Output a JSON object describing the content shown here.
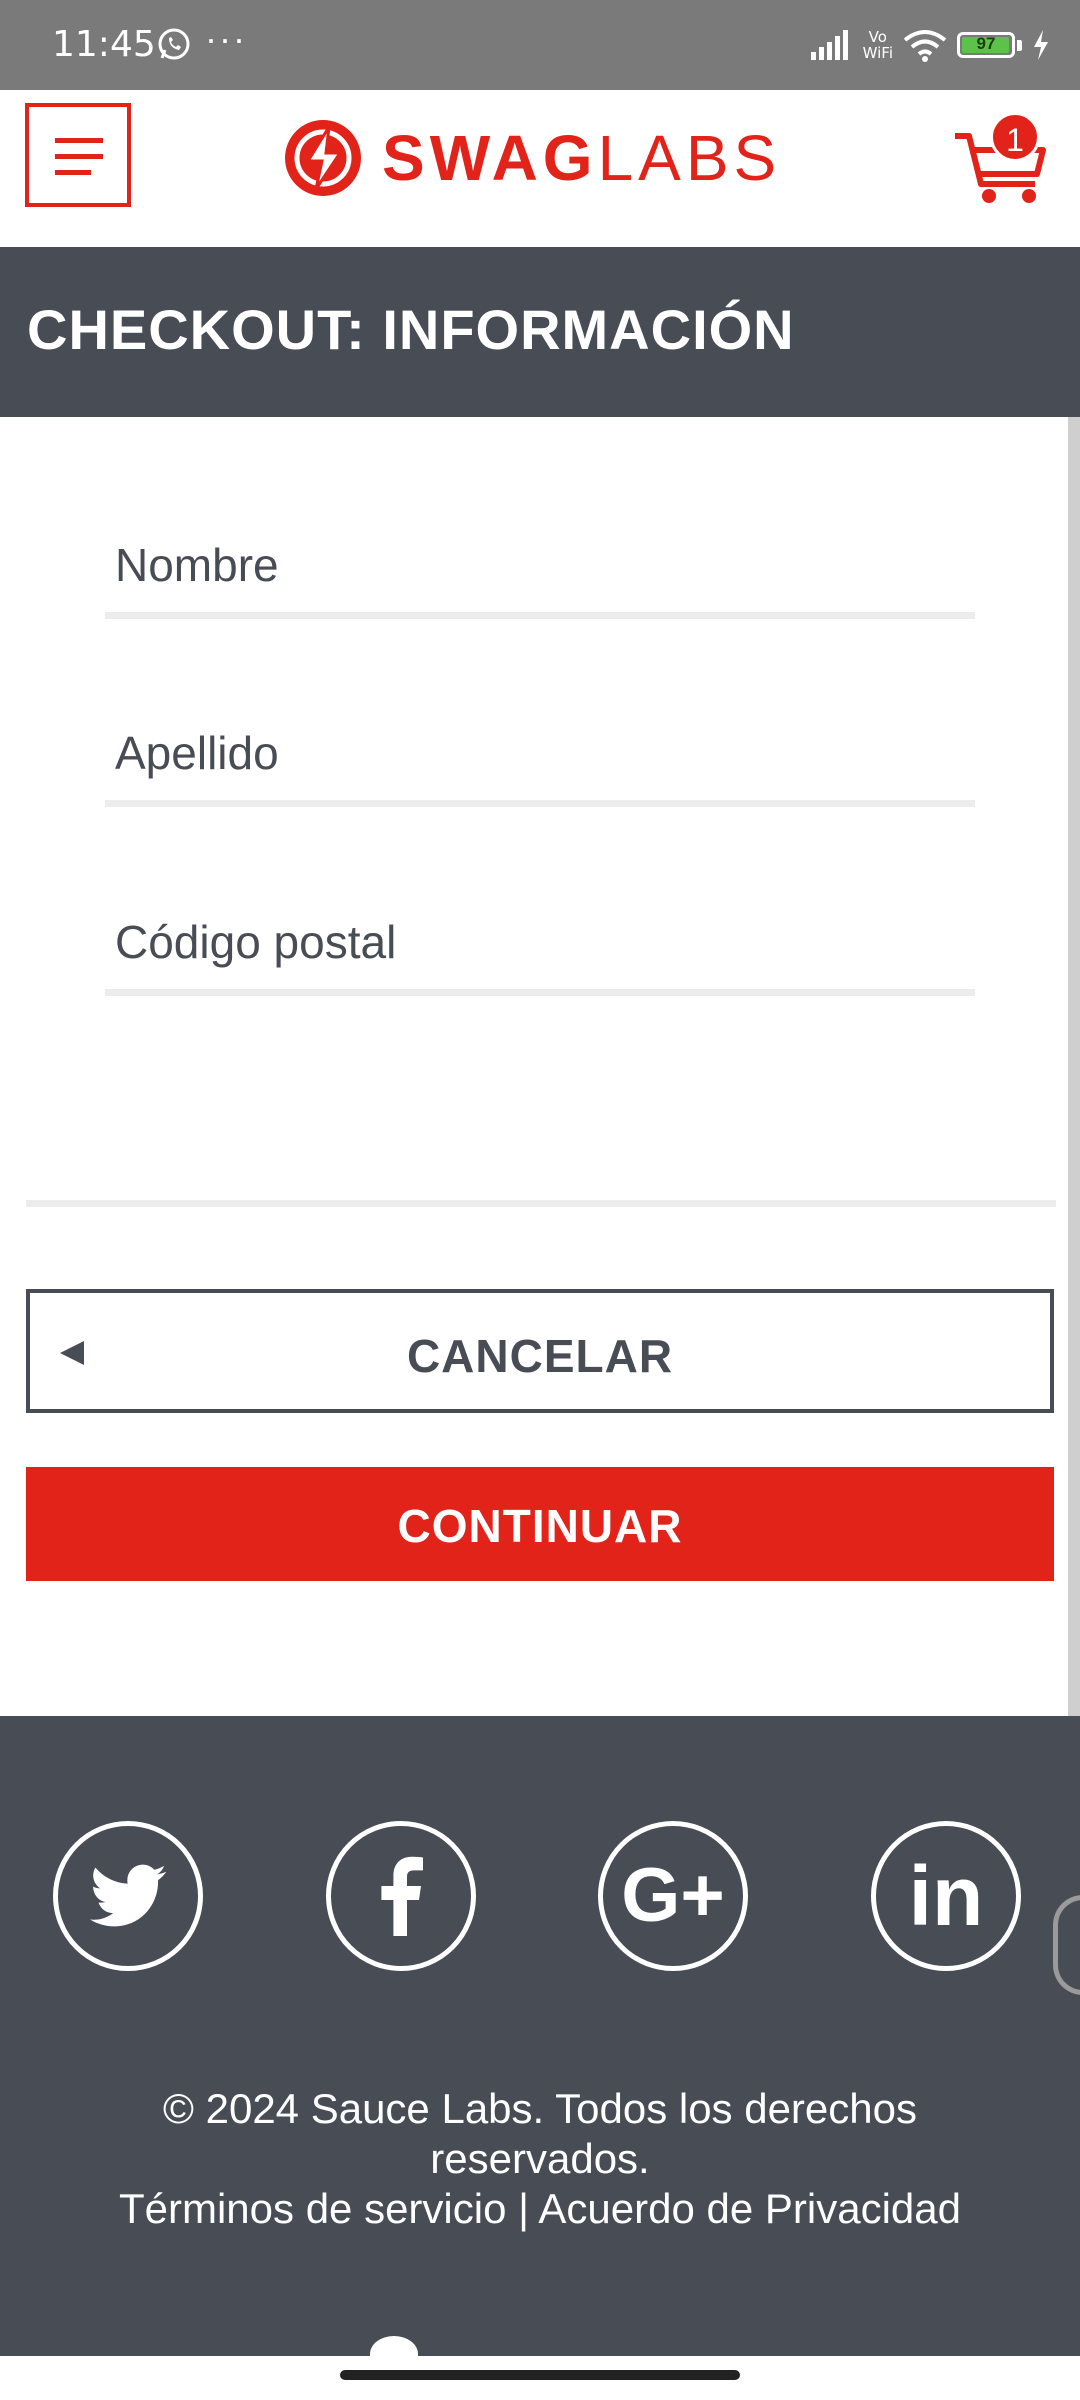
{
  "status_bar": {
    "time": "11:45",
    "more": "···",
    "vowifi_line1": "Vo",
    "vowifi_line2": "WiFi",
    "battery": "97",
    "battery_color": "#5cc24a"
  },
  "header": {
    "logo_bold": "SWAG",
    "logo_light": "LABS",
    "cart_count": "1",
    "brand_color": "#e2231a"
  },
  "page": {
    "title": "CHECKOUT: INFORMACIÓN"
  },
  "form": {
    "first_name_placeholder": "Nombre",
    "last_name_placeholder": "Apellido",
    "postal_code_placeholder": "Código postal"
  },
  "buttons": {
    "cancel": "CANCELAR",
    "continue": "CONTINUAR"
  },
  "footer": {
    "social_icons": [
      "twitter-icon",
      "facebook-icon",
      "google-plus-icon",
      "linkedin-icon"
    ],
    "copyright_line1": "© 2024 Sauce Labs. Todos los derechos",
    "copyright_line2": "reservados.",
    "terms": "Términos de servicio",
    "separator": "|",
    "privacy": "Acuerdo de Privacidad"
  }
}
